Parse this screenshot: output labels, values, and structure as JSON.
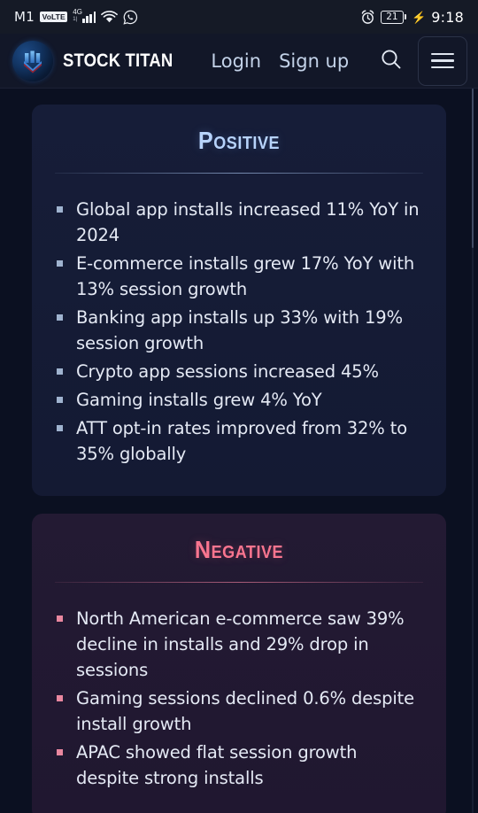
{
  "status_bar": {
    "carrier": "M1",
    "network_badge": "VoLTE",
    "network_type": "4G",
    "network_sub": "1|",
    "wifi_icon": "wifi-icon",
    "whatsapp_icon": "whatsapp-icon",
    "alarm_icon": "alarm-icon",
    "battery_level": "21",
    "charging_icon": "lightning-bolt-icon",
    "time": "9:18"
  },
  "header": {
    "logo_icon": "stock-titan-logo-icon",
    "brand": "STOCK TITAN",
    "nav": [
      {
        "label": "Login"
      },
      {
        "label": "Sign up"
      }
    ],
    "search_icon": "search-icon",
    "menu_icon": "hamburger-menu-icon"
  },
  "main": {
    "cards": [
      {
        "id": "positive",
        "title": "Positive",
        "accent": "#b7d3fb",
        "bullets": [
          "Global app installs increased 11% YoY in 2024",
          "E-commerce installs grew 17% YoY with 13% session growth",
          "Banking app installs up 33% with 19% session growth",
          "Crypto app sessions increased 45%",
          "Gaming installs grew 4% YoY",
          "ATT opt-in rates improved from 32% to 35% globally"
        ]
      },
      {
        "id": "negative",
        "title": "Negative",
        "accent": "#f9758f",
        "bullets": [
          "North American e-commerce saw 39% decline in installs and 29% drop in sessions",
          "Gaming sessions declined 0.6% despite install growth",
          "APAC showed flat session growth despite strong installs"
        ]
      }
    ]
  }
}
